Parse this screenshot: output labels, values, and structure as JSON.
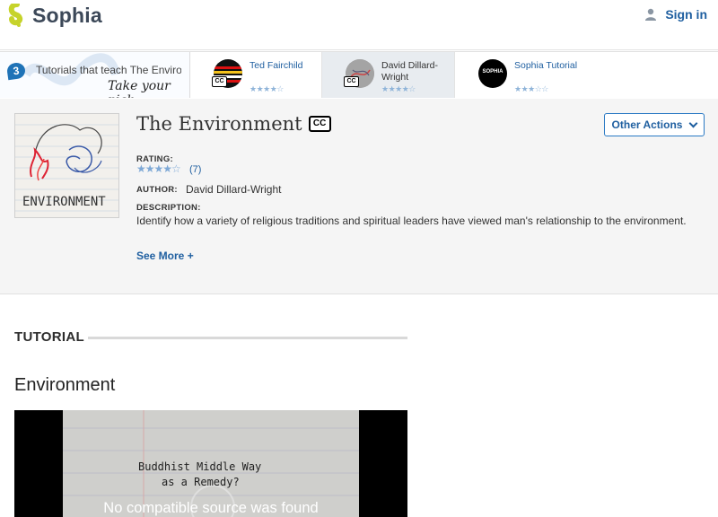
{
  "header": {
    "brand": "Sophia",
    "signin_label": "Sign in"
  },
  "picker": {
    "count": "3",
    "intro": "Tutorials that teach The Environment",
    "take_pick": "Take your pick:",
    "tutorials": [
      {
        "author": "Ted Fairchild",
        "stars": "★★★★☆",
        "cc": "CC"
      },
      {
        "author": "David Dillard-Wright",
        "stars": "★★★★☆",
        "cc": "CC"
      },
      {
        "author": "Sophia Tutorial",
        "stars": "★★★☆☆",
        "thumb_text": "SOPHIA"
      }
    ]
  },
  "tutorial_info": {
    "title": "The Environment",
    "cc": "CC",
    "other_actions_label": "Other Actions",
    "rating_label": "RATING:",
    "rating_stars": "★★★★☆",
    "rating_value": 4,
    "rating_count": "(7)",
    "author_label": "AUTHOR:",
    "author": "David Dillard-Wright",
    "description_label": "DESCRIPTION:",
    "description": "Identify how a variety of religious traditions and spiritual leaders have viewed man's relationship to the environment.",
    "see_more": "See More +",
    "cover_text": "ENVIRONMENT"
  },
  "content": {
    "section_label": "TUTORIAL",
    "heading": "Environment",
    "video_text_line1": "Buddhist  Middle  Way",
    "video_text_line2": "as  a  Remedy?",
    "video_error": "No compatible source was found"
  },
  "colors": {
    "brand_green": "#c6d32b",
    "link_blue": "#1f5fa0",
    "star_blue": "#7fa9d6"
  }
}
